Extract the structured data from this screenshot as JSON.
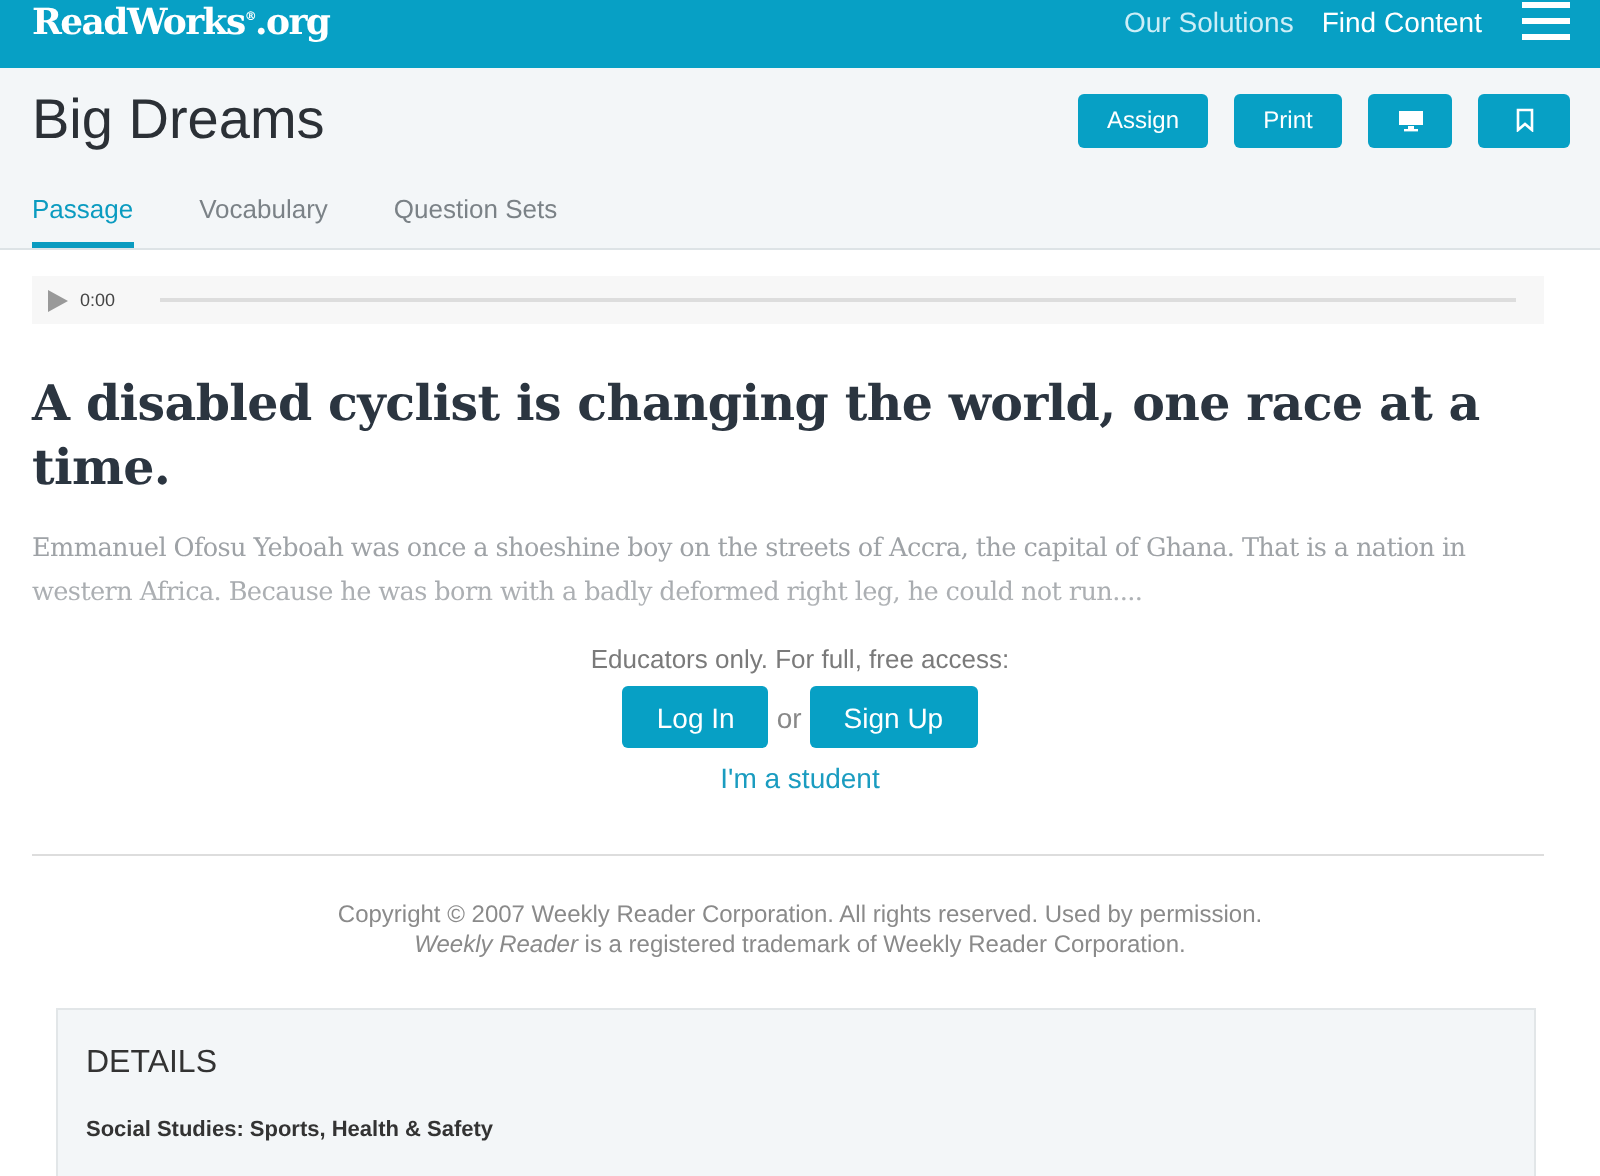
{
  "header": {
    "logo": "ReadWorks$^{®}$.org",
    "nav": [
      "Our Solutions",
      "Find Content"
    ]
  },
  "title": "Big Dreams",
  "actions": [
    {
      "kind": "text",
      "label": "Assign"
    },
    {
      "kind": "text",
      "label": "Print"
    },
    {
      "kind": "monitor"
    },
    {
      "kind": "bookmark"
    }
  ],
  "tabs": [
    {
      "label": "Passage",
      "selected": true
    },
    {
      "label": "Vocabulary",
      "selected": false
    },
    {
      "label": "Question Sets",
      "selected": false
    }
  ],
  "audio": {
    "time": "0:00"
  },
  "headline": "A disabled cyclist is changing the world, one race at a time.",
  "excerpt": "Emmanuel Ofosu Yeboah was once a shoeshine boy on the streets of Accra, the capital of Ghana. That is a nation in western Africa. Because he was born with a badly deformed right leg, he could not run....",
  "access": {
    "prompt": "Educators only. For full, free access:",
    "login": "Log In",
    "or": "or",
    "signup": "Sign Up",
    "student": "I'm a student"
  },
  "copyright": [
    "Copyright © 2007 Weekly Reader Corporation. All rights reserved. Used by permission.",
    "*Weekly Reader* is a registered trademark of Weekly Reader Corporation."
  ],
  "details": {
    "heading": "DETAILS",
    "subject": "Social Studies: Sports, Health & Safety"
  }
}
